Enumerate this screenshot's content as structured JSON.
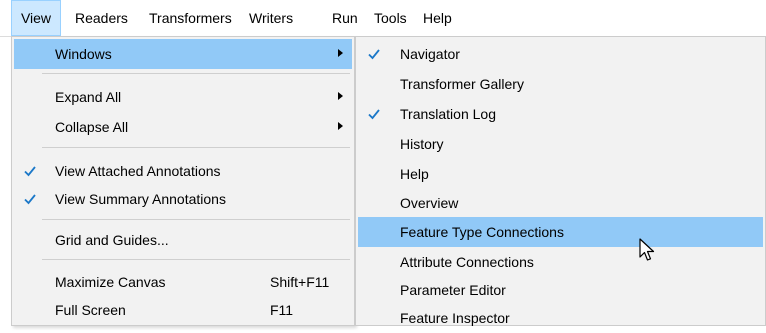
{
  "menubar": {
    "items": [
      "View",
      "Readers",
      "Transformers",
      "Writers",
      "Run",
      "Tools",
      "Help"
    ]
  },
  "view_menu": {
    "items": [
      {
        "label": "Windows",
        "submenu": true,
        "highlighted": true
      },
      {
        "label": "Expand All",
        "submenu": true
      },
      {
        "label": "Collapse All",
        "submenu": true
      },
      {
        "label": "View Attached Annotations",
        "checked": true
      },
      {
        "label": "View Summary Annotations",
        "checked": true
      },
      {
        "label": "Grid and Guides..."
      },
      {
        "label": "Maximize Canvas",
        "shortcut": "Shift+F11"
      },
      {
        "label": "Full Screen",
        "shortcut": "F11"
      }
    ]
  },
  "windows_menu": {
    "items": [
      {
        "label": "Navigator",
        "checked": true
      },
      {
        "label": "Transformer Gallery"
      },
      {
        "label": "Translation Log",
        "checked": true
      },
      {
        "label": "History"
      },
      {
        "label": "Help"
      },
      {
        "label": "Overview"
      },
      {
        "label": "Feature Type Connections",
        "highlighted": true
      },
      {
        "label": "Attribute Connections"
      },
      {
        "label": "Parameter Editor"
      },
      {
        "label": "Feature Inspector"
      }
    ]
  },
  "colors": {
    "menu_bg": "#f2f2f2",
    "highlight": "#91c9f7",
    "menubar_active": "#cce8ff",
    "checkmark": "#1b78c8"
  }
}
